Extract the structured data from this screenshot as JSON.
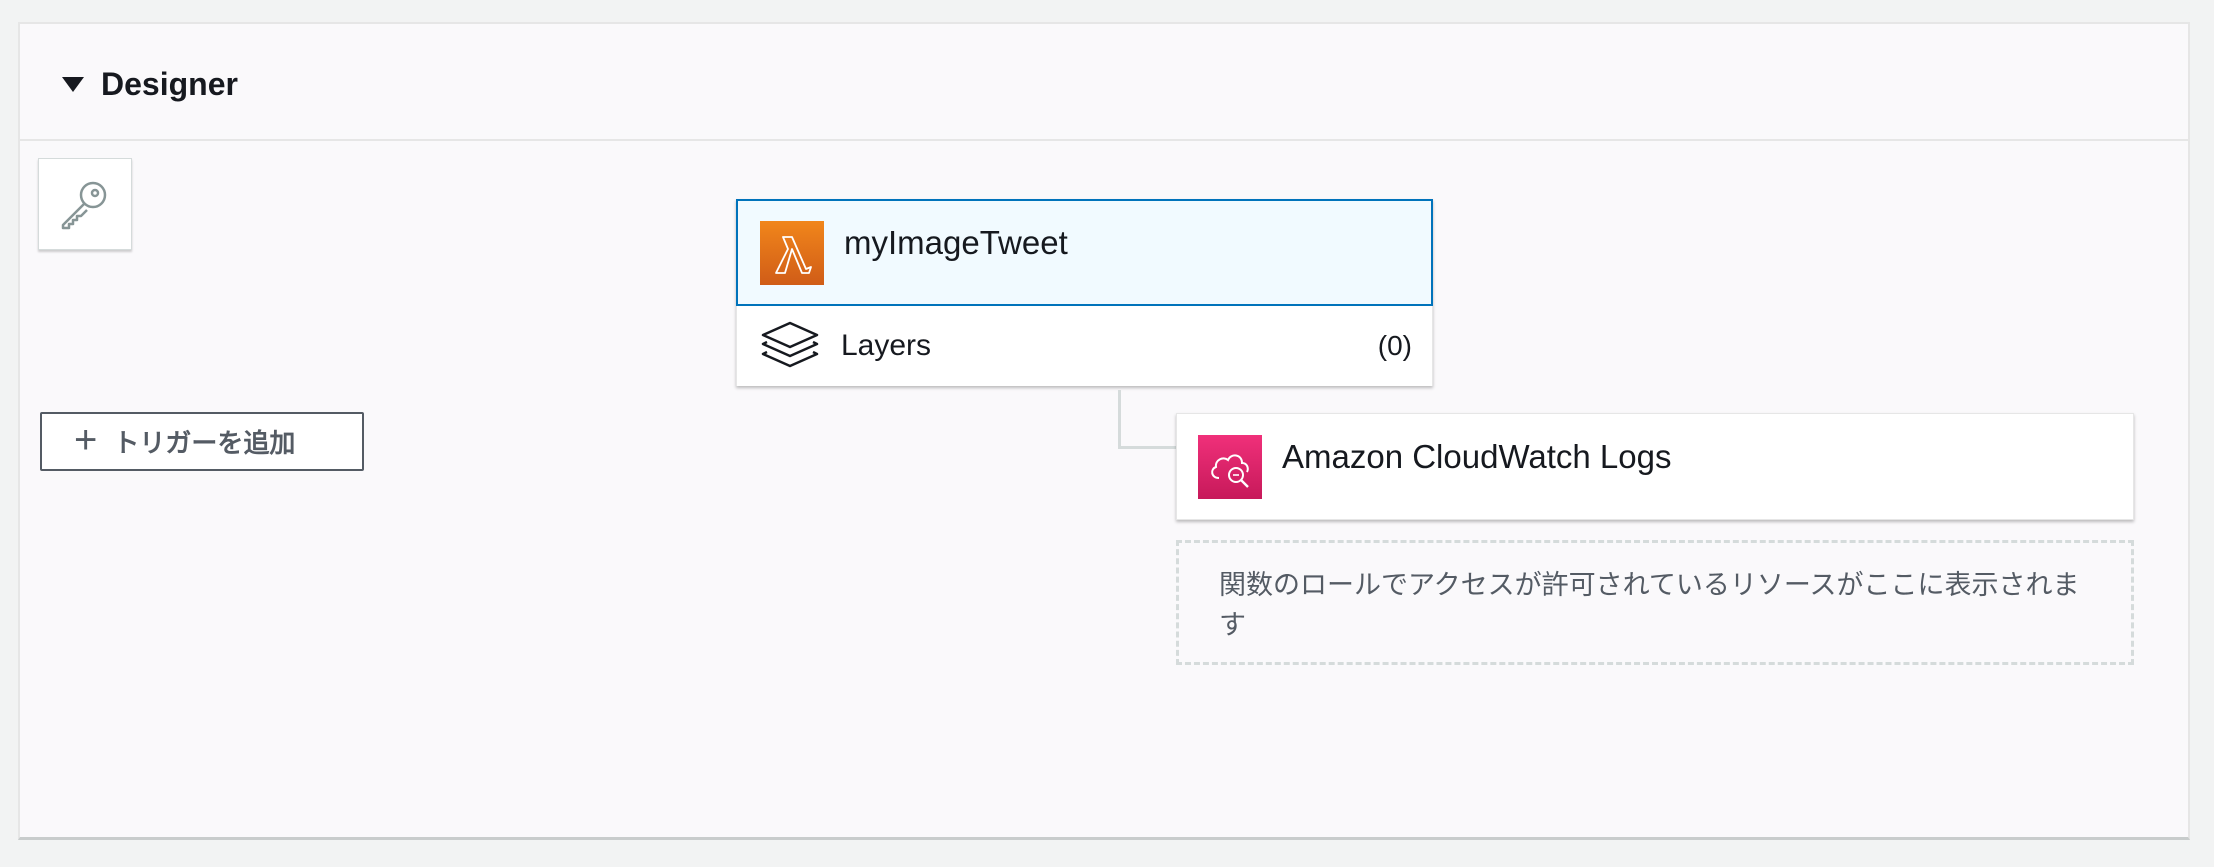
{
  "designer": {
    "title": "Designer",
    "add_trigger_label": "トリガーを追加",
    "function": {
      "name": "myImageTweet",
      "icon": "lambda-icon",
      "layers_label": "Layers",
      "layers_count": "(0)"
    },
    "resource": {
      "name": "Amazon CloudWatch Logs",
      "icon": "cloudwatch-logs-icon"
    },
    "resource_hint": "関数のロールでアクセスが許可されているリソースがここに表示されます"
  },
  "colors": {
    "lambda": "#e9791b",
    "cloudwatch": "#e12b6f",
    "selected_border": "#0073bb",
    "selected_bg": "#f1faff"
  }
}
